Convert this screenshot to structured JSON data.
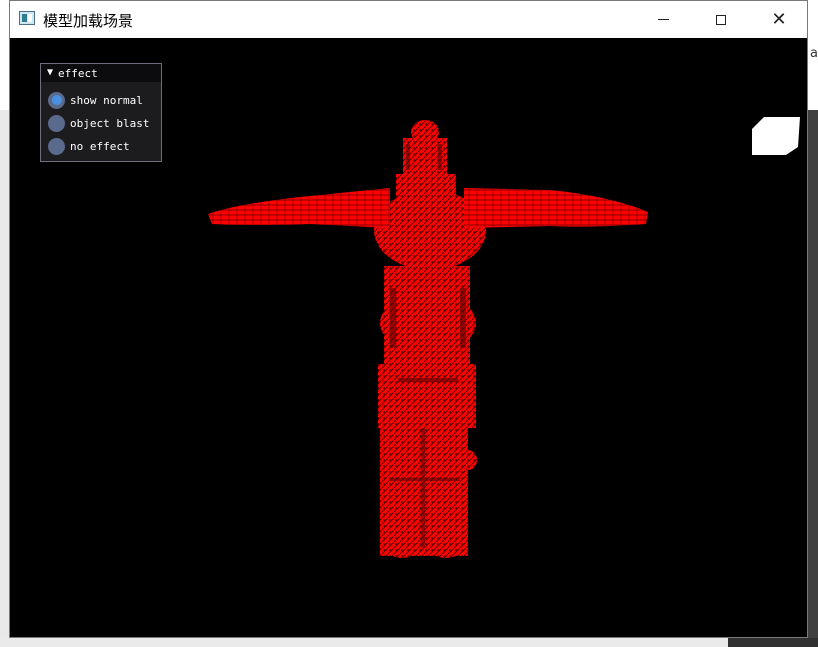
{
  "window": {
    "title": "模型加载场景"
  },
  "caption_buttons": {
    "minimize_icon": "minimize-icon",
    "maximize_icon": "maximize-icon",
    "close_icon": "close-icon",
    "close_glyph": "✕"
  },
  "effect_panel": {
    "header": "effect",
    "collapse_glyph": "▼",
    "options": [
      {
        "label": "show normal",
        "selected": true
      },
      {
        "label": "object blast",
        "selected": false
      },
      {
        "label": "no effect",
        "selected": false
      }
    ]
  },
  "desktop": {
    "right_edge_glyph": "a"
  },
  "colors": {
    "model": "#ff0000",
    "viewport_bg": "#000000",
    "radio_checked": "#4a90e2",
    "radio_bg": "#5a6a8c"
  }
}
